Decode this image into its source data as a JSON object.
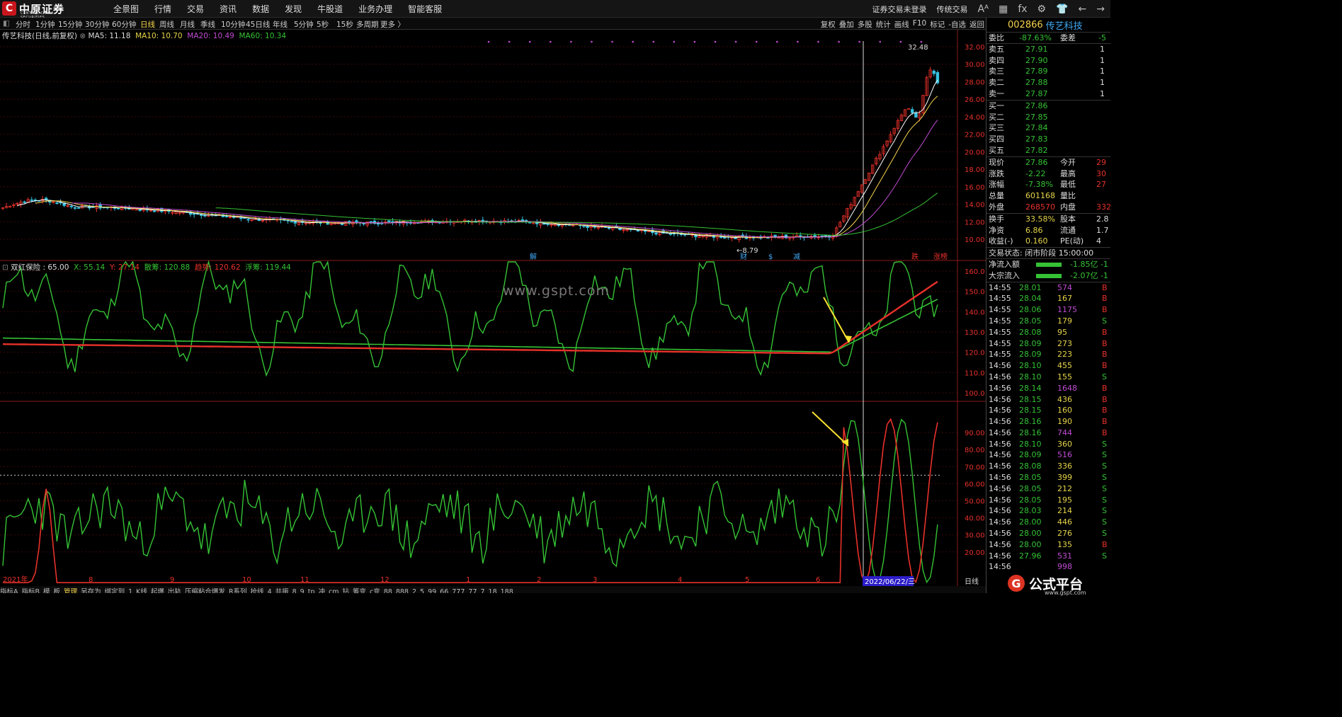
{
  "logo": {
    "mark": "C",
    "text": "中原证券",
    "sub": "CENTRAL CHINA SECURITIES"
  },
  "menu": [
    "全景图",
    "行情",
    "交易",
    "资讯",
    "数据",
    "发现",
    "牛股道",
    "业务办理",
    "智能客服"
  ],
  "topright": {
    "login": "证券交易未登录",
    "classic": "传统交易",
    "icons": [
      "Aᴬ",
      "▦",
      "fx",
      "⚙",
      "👕",
      "←",
      "→"
    ]
  },
  "periods": [
    "分时",
    "1分钟",
    "15分钟",
    "30分钟",
    "60分钟",
    "日线",
    "周线",
    "月线",
    "季线",
    "10分钟",
    "45日线",
    "年线",
    "5分钟",
    "5秒",
    "15秒",
    "多周期",
    "更多 〉"
  ],
  "active_period": "日线",
  "toolbar_right": [
    "复权",
    "叠加",
    "多股",
    "统计",
    "画线",
    "F10",
    "标记",
    "-自选",
    "返回"
  ],
  "ma_line": {
    "title": "传艺科技(日线,前复权)",
    "ma5": "MA5: 11.18",
    "ma10": "MA10: 10.70",
    "ma20": "MA20: 10.49",
    "ma60": "MA60: 10.34"
  },
  "indicator_line": {
    "name": "双红保险 : 65.00",
    "x": "X: 55.14",
    "y": "Y: 27.14",
    "san": "散筹: 120.88",
    "zhu": "趋势: 120.62",
    "fu": "浮筹: 119.44"
  },
  "price_axis": [
    "32.00",
    "30.00",
    "28.00",
    "26.00",
    "24.00",
    "22.00",
    "20.00",
    "18.00",
    "16.00",
    "14.00",
    "12.00",
    "10.00"
  ],
  "ind_axis": [
    "160.0",
    "150.0",
    "140.0",
    "130.0",
    "120.0",
    "110.0",
    "100.0"
  ],
  "ind2_axis": [
    "90.00",
    "80.00",
    "70.00",
    "60.00",
    "50.00",
    "40.00",
    "30.00",
    "20.00"
  ],
  "month_labels": [
    "2021年",
    "8",
    "9",
    "10",
    "11",
    "12",
    "1",
    "2",
    "3",
    "4",
    "5",
    "6"
  ],
  "date_label": "2022/06/22/三",
  "period_tag": "日线",
  "high_label": "32.48",
  "low_label": "8.79",
  "event_marks": [
    "解",
    "财",
    "$",
    "减",
    "跌",
    "涨榜"
  ],
  "watermark": "www.gspt.com",
  "bottom_tabs": [
    "指标A",
    "指标B",
    "模",
    "板",
    "管理",
    "另存为",
    "绑定到",
    "1",
    "K线",
    "起爆",
    "出轨",
    "压缩粘合爆发",
    "R系列",
    "抢线",
    "4",
    "共振",
    "8",
    "9",
    "tp",
    "冲",
    "cm",
    "钻",
    "筹变",
    "c变",
    "88",
    "888",
    "2",
    "5",
    "99",
    "66",
    "777",
    "77",
    "7",
    "18",
    "188"
  ],
  "bottom_active": "管理",
  "quote": {
    "code": "002866",
    "name": "传艺科技",
    "weibi": {
      "label": "委比",
      "value": "-87.63%",
      "label2": "委差",
      "value2": "-5"
    },
    "asks": [
      {
        "label": "卖五",
        "price": "27.91",
        "vol": "1"
      },
      {
        "label": "卖四",
        "price": "27.90",
        "vol": "1"
      },
      {
        "label": "卖三",
        "price": "27.89",
        "vol": "1"
      },
      {
        "label": "卖二",
        "price": "27.88",
        "vol": "1"
      },
      {
        "label": "卖一",
        "price": "27.87",
        "vol": "1"
      }
    ],
    "bids": [
      {
        "label": "买一",
        "price": "27.86"
      },
      {
        "label": "买二",
        "price": "27.85"
      },
      {
        "label": "买三",
        "price": "27.84"
      },
      {
        "label": "买四",
        "price": "27.83"
      },
      {
        "label": "买五",
        "price": "27.82"
      }
    ],
    "stats": [
      {
        "l1": "现价",
        "v1": "27.86",
        "l2": "今开",
        "v2": "29"
      },
      {
        "l1": "涨跌",
        "v1": "-2.22",
        "l2": "最高",
        "v2": "30"
      },
      {
        "l1": "涨幅",
        "v1": "-7.38%",
        "l2": "最低",
        "v2": "27"
      },
      {
        "l1": "总量",
        "v1": "601168",
        "l2": "量比",
        "v2": ""
      },
      {
        "l1": "外盘",
        "v1": "268570",
        "l2": "内盘",
        "v2": "332"
      }
    ],
    "stats2": [
      {
        "l1": "换手",
        "v1": "33.58%",
        "l2": "股本",
        "v2": "2.8"
      },
      {
        "l1": "净资",
        "v1": "6.86",
        "l2": "流通",
        "v2": "1.7"
      },
      {
        "l1": "收益(-)",
        "v1": "0.160",
        "l2": "PE(动)",
        "v2": "4"
      }
    ],
    "status": "交易状态: 闭市阶段 15:00:00",
    "flows": [
      {
        "label": "净流入额",
        "value": "-1.85亿 -1"
      },
      {
        "label": "大宗流入",
        "value": "-2.07亿 -1"
      }
    ],
    "ticks": [
      {
        "t": "14:55",
        "p": "28.01",
        "v": "574",
        "s": "B"
      },
      {
        "t": "14:55",
        "p": "28.04",
        "v": "167",
        "s": "B"
      },
      {
        "t": "14:55",
        "p": "28.06",
        "v": "1175",
        "s": "B"
      },
      {
        "t": "14:55",
        "p": "28.05",
        "v": "179",
        "s": "S"
      },
      {
        "t": "14:55",
        "p": "28.08",
        "v": "95",
        "s": "B"
      },
      {
        "t": "14:55",
        "p": "28.09",
        "v": "273",
        "s": "B"
      },
      {
        "t": "14:55",
        "p": "28.09",
        "v": "223",
        "s": "B"
      },
      {
        "t": "14:56",
        "p": "28.10",
        "v": "455",
        "s": "B"
      },
      {
        "t": "14:56",
        "p": "28.10",
        "v": "155",
        "s": "S"
      },
      {
        "t": "14:56",
        "p": "28.14",
        "v": "1648",
        "s": "B"
      },
      {
        "t": "14:56",
        "p": "28.15",
        "v": "436",
        "s": "B"
      },
      {
        "t": "14:56",
        "p": "28.15",
        "v": "160",
        "s": "B"
      },
      {
        "t": "14:56",
        "p": "28.16",
        "v": "190",
        "s": "B"
      },
      {
        "t": "14:56",
        "p": "28.16",
        "v": "744",
        "s": "B"
      },
      {
        "t": "14:56",
        "p": "28.10",
        "v": "360",
        "s": "S"
      },
      {
        "t": "14:56",
        "p": "28.09",
        "v": "516",
        "s": "S"
      },
      {
        "t": "14:56",
        "p": "28.08",
        "v": "336",
        "s": "S"
      },
      {
        "t": "14:56",
        "p": "28.05",
        "v": "399",
        "s": "S"
      },
      {
        "t": "14:56",
        "p": "28.05",
        "v": "212",
        "s": "S"
      },
      {
        "t": "14:56",
        "p": "28.05",
        "v": "195",
        "s": "S"
      },
      {
        "t": "14:56",
        "p": "28.03",
        "v": "214",
        "s": "S"
      },
      {
        "t": "14:56",
        "p": "28.00",
        "v": "446",
        "s": "S"
      },
      {
        "t": "14:56",
        "p": "28.00",
        "v": "276",
        "s": "S"
      },
      {
        "t": "14:56",
        "p": "28.00",
        "v": "135",
        "s": "B"
      },
      {
        "t": "14:56",
        "p": "27.96",
        "v": "531",
        "s": "S"
      },
      {
        "t": "14:56",
        "p": "",
        "v": "998",
        "s": ""
      }
    ]
  },
  "badge": {
    "mark": "G",
    "text": "公式平台",
    "url": "www.gspt.com"
  },
  "colors": {
    "up": "#e8312a",
    "down": "#35c2e0",
    "ma5": "#ffffff",
    "ma10": "#f5d34b",
    "ma20": "#c04bd3",
    "ma60": "#35c235",
    "grid": "#3a0a0a"
  }
}
